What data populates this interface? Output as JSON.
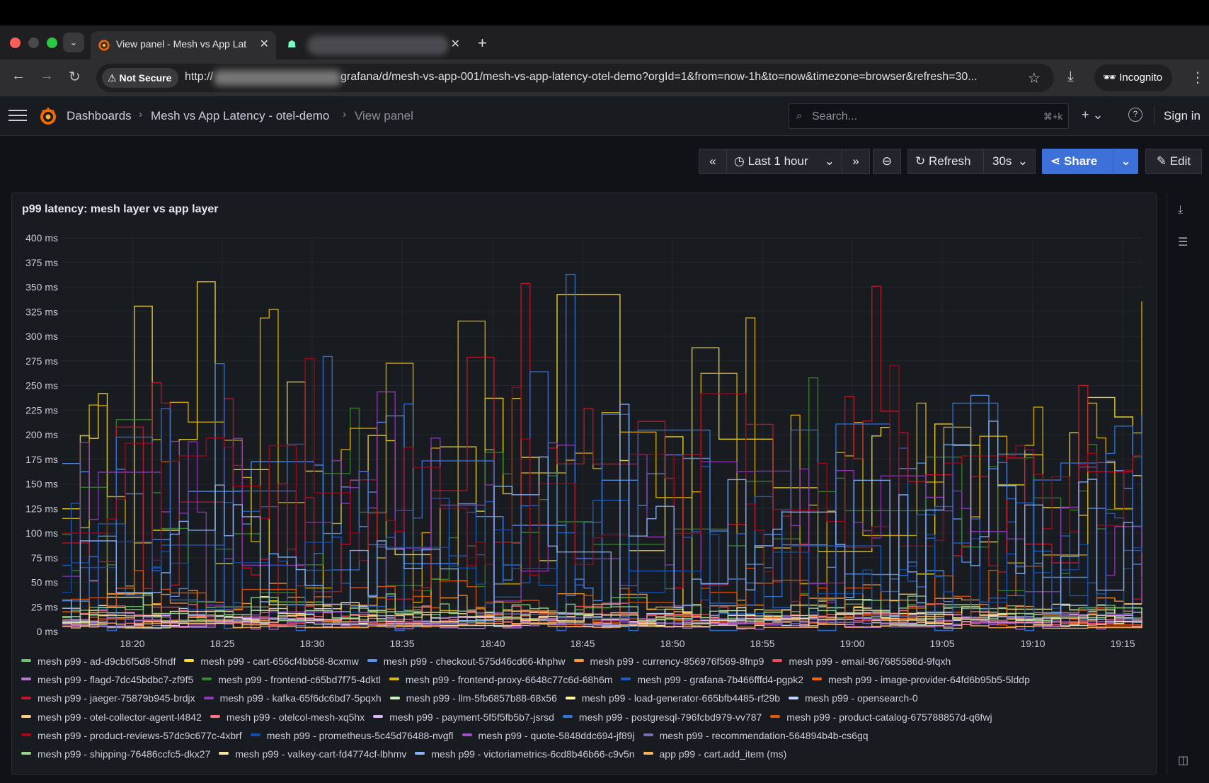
{
  "browser": {
    "active_tab_title": "View panel - Mesh vs App Lat",
    "new_tab_symbol": "+",
    "not_secure_label": "Not Secure",
    "url_scheme": "http://",
    "url_path": "grafana/d/mesh-vs-app-001/mesh-vs-app-latency-otel-demo?orgId=1&from=now-1h&to=now&timezone=browser&refresh=30...",
    "incognito_label": "Incognito"
  },
  "nav": {
    "crumbs": [
      "Dashboards",
      "Mesh vs App Latency - otel-demo",
      "View panel"
    ],
    "search_placeholder": "Search...",
    "search_shortcut": "⌘+k",
    "sign_in": "Sign in"
  },
  "toolbar": {
    "time_range": "Last 1 hour",
    "refresh": "Refresh",
    "refresh_interval": "30s",
    "share": "Share",
    "edit": "Edit"
  },
  "panel": {
    "title": "p99 latency: mesh layer vs app layer"
  },
  "chart_data": {
    "type": "line",
    "title": "p99 latency: mesh layer vs app layer",
    "y_ticks": [
      "400 ms",
      "375 ms",
      "350 ms",
      "325 ms",
      "300 ms",
      "275 ms",
      "250 ms",
      "225 ms",
      "200 ms",
      "175 ms",
      "150 ms",
      "125 ms",
      "100 ms",
      "75 ms",
      "50 ms",
      "25 ms",
      "0 ms"
    ],
    "ylim": [
      0,
      400
    ],
    "x_ticks": [
      "18:20",
      "18:25",
      "18:30",
      "18:35",
      "18:40",
      "18:45",
      "18:50",
      "18:55",
      "19:00",
      "19:05",
      "19:10",
      "19:15"
    ],
    "grid": true,
    "legend_placement": "bottom",
    "series": [
      {
        "name": "mesh p99 - ad-d9cb6f5d8-5fndf",
        "color": "#73bf69",
        "base": 15,
        "amp": 20
      },
      {
        "name": "mesh p99 - cart-656cf4bb58-8cxmw",
        "color": "#fade2a",
        "base": 90,
        "amp": 240
      },
      {
        "name": "mesh p99 - checkout-575d46cd66-khphw",
        "color": "#5794f2",
        "base": 80,
        "amp": 150
      },
      {
        "name": "mesh p99 - currency-856976f569-8fnp9",
        "color": "#ff9830",
        "base": 20,
        "amp": 30
      },
      {
        "name": "mesh p99 - email-867685586d-9fqxh",
        "color": "#f2495c",
        "base": 10,
        "amp": 15
      },
      {
        "name": "mesh p99 - flagd-7dc45bdbc7-zf9f5",
        "color": "#b877d9",
        "base": 5,
        "amp": 8
      },
      {
        "name": "mesh p99 - frontend-c65bd7f75-4dktl",
        "color": "#37872d",
        "base": 80,
        "amp": 150
      },
      {
        "name": "mesh p99 - frontend-proxy-6648c77c6d-68h6m",
        "color": "#e0b400",
        "base": 90,
        "amp": 220
      },
      {
        "name": "mesh p99 - grafana-7b466fffd4-pgpk2",
        "color": "#1f60c4",
        "base": 60,
        "amp": 120
      },
      {
        "name": "mesh p99 - image-provider-64fd6b95b5-5lddp",
        "color": "#fa6400",
        "base": 8,
        "amp": 10
      },
      {
        "name": "mesh p99 - jaeger-75879b945-brdjx",
        "color": "#c4162a",
        "base": 90,
        "amp": 260
      },
      {
        "name": "mesh p99 - kafka-65f6dc6bd7-5pqxh",
        "color": "#8f3bb8",
        "base": 80,
        "amp": 180
      },
      {
        "name": "mesh p99 - llm-5fb6857b88-68x56",
        "color": "#c8f2c2",
        "base": 10,
        "amp": 20
      },
      {
        "name": "mesh p99 - load-generator-665bfb4485-rf29b",
        "color": "#fff899",
        "base": 15,
        "amp": 20
      },
      {
        "name": "mesh p99 - opensearch-0",
        "color": "#c0d8ff",
        "base": 10,
        "amp": 15
      },
      {
        "name": "mesh p99 - otel-collector-agent-l4842",
        "color": "#ffcb7d",
        "base": 10,
        "amp": 12
      },
      {
        "name": "mesh p99 - otelcol-mesh-xq5hx",
        "color": "#ff7383",
        "base": 12,
        "amp": 15
      },
      {
        "name": "mesh p99 - payment-5f5f5fb5b7-jsrsd",
        "color": "#deb6f2",
        "base": 8,
        "amp": 10
      },
      {
        "name": "mesh p99 - postgresql-796fcbd979-vv787",
        "color": "#3274d9",
        "base": 60,
        "amp": 270
      },
      {
        "name": "mesh p99 - product-catalog-675788857d-q6fwj",
        "color": "#e55400",
        "base": 20,
        "amp": 40
      },
      {
        "name": "mesh p99 - product-reviews-57dc9c677c-4xbrf",
        "color": "#ad0317",
        "base": 100,
        "amp": 150
      },
      {
        "name": "mesh p99 - prometheus-5c45d76488-nvgfl",
        "color": "#1250b0",
        "base": 40,
        "amp": 80
      },
      {
        "name": "mesh p99 - quote-5848ddc694-jf89j",
        "color": "#a352cc",
        "base": 8,
        "amp": 10
      },
      {
        "name": "mesh p99 - recommendation-564894b4b-cs6gq",
        "color": "#7c6cb7",
        "base": 10,
        "amp": 12
      },
      {
        "name": "mesh p99 - shipping-76486ccfc5-dkx27",
        "color": "#96d98d",
        "base": 15,
        "amp": 20
      },
      {
        "name": "mesh p99 - valkey-cart-fd4774cf-lbhmv",
        "color": "#fce2a2",
        "base": 10,
        "amp": 12
      },
      {
        "name": "mesh p99 - victoriametrics-6cd8b46b66-c9v5n",
        "color": "#8ab8ff",
        "base": 60,
        "amp": 150
      },
      {
        "name": "app p99 - cart.add_item (ms)",
        "color": "#ffb357",
        "base": 5,
        "amp": 5
      }
    ]
  },
  "colors": {
    "accent": "#3d71d9",
    "panel_bg": "#181b1f",
    "page_bg": "#111217"
  }
}
